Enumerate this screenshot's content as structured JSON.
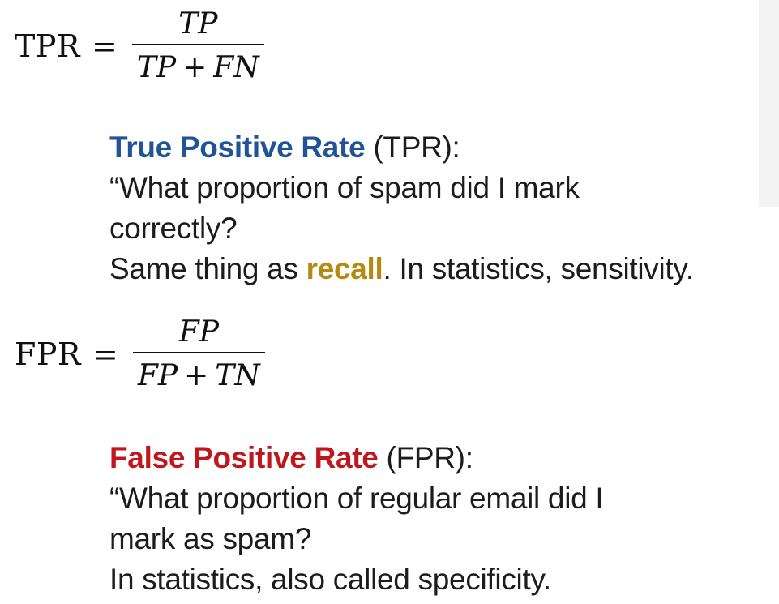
{
  "tpr_formula": {
    "lhs": "TPR",
    "equals": "=",
    "numerator": "TP",
    "denominator": {
      "left": "TP",
      "operator": "+",
      "right": "FN"
    }
  },
  "tpr_description": {
    "term": "True Positive Rate",
    "abbrev": " (TPR):",
    "question_line1": "“What proportion of spam did I mark",
    "question_line2": "correctly?",
    "same_prefix": "Same thing as ",
    "recall": "recall",
    "same_suffix": ". In statistics, sensitivity.",
    "term_color": "#1f5597",
    "recall_color": "#b58a10"
  },
  "fpr_formula": {
    "lhs": "FPR",
    "equals": "=",
    "numerator": "FP",
    "denominator": {
      "left": "FP",
      "operator": "+",
      "right": "TN"
    }
  },
  "fpr_description": {
    "term": "False Positive Rate",
    "abbrev": " (FPR):",
    "question_line1": "“What proportion of regular email did I",
    "question_line2": "mark as spam?",
    "stats_line": "In statistics, also called specificity.",
    "term_color": "#c0161c"
  }
}
